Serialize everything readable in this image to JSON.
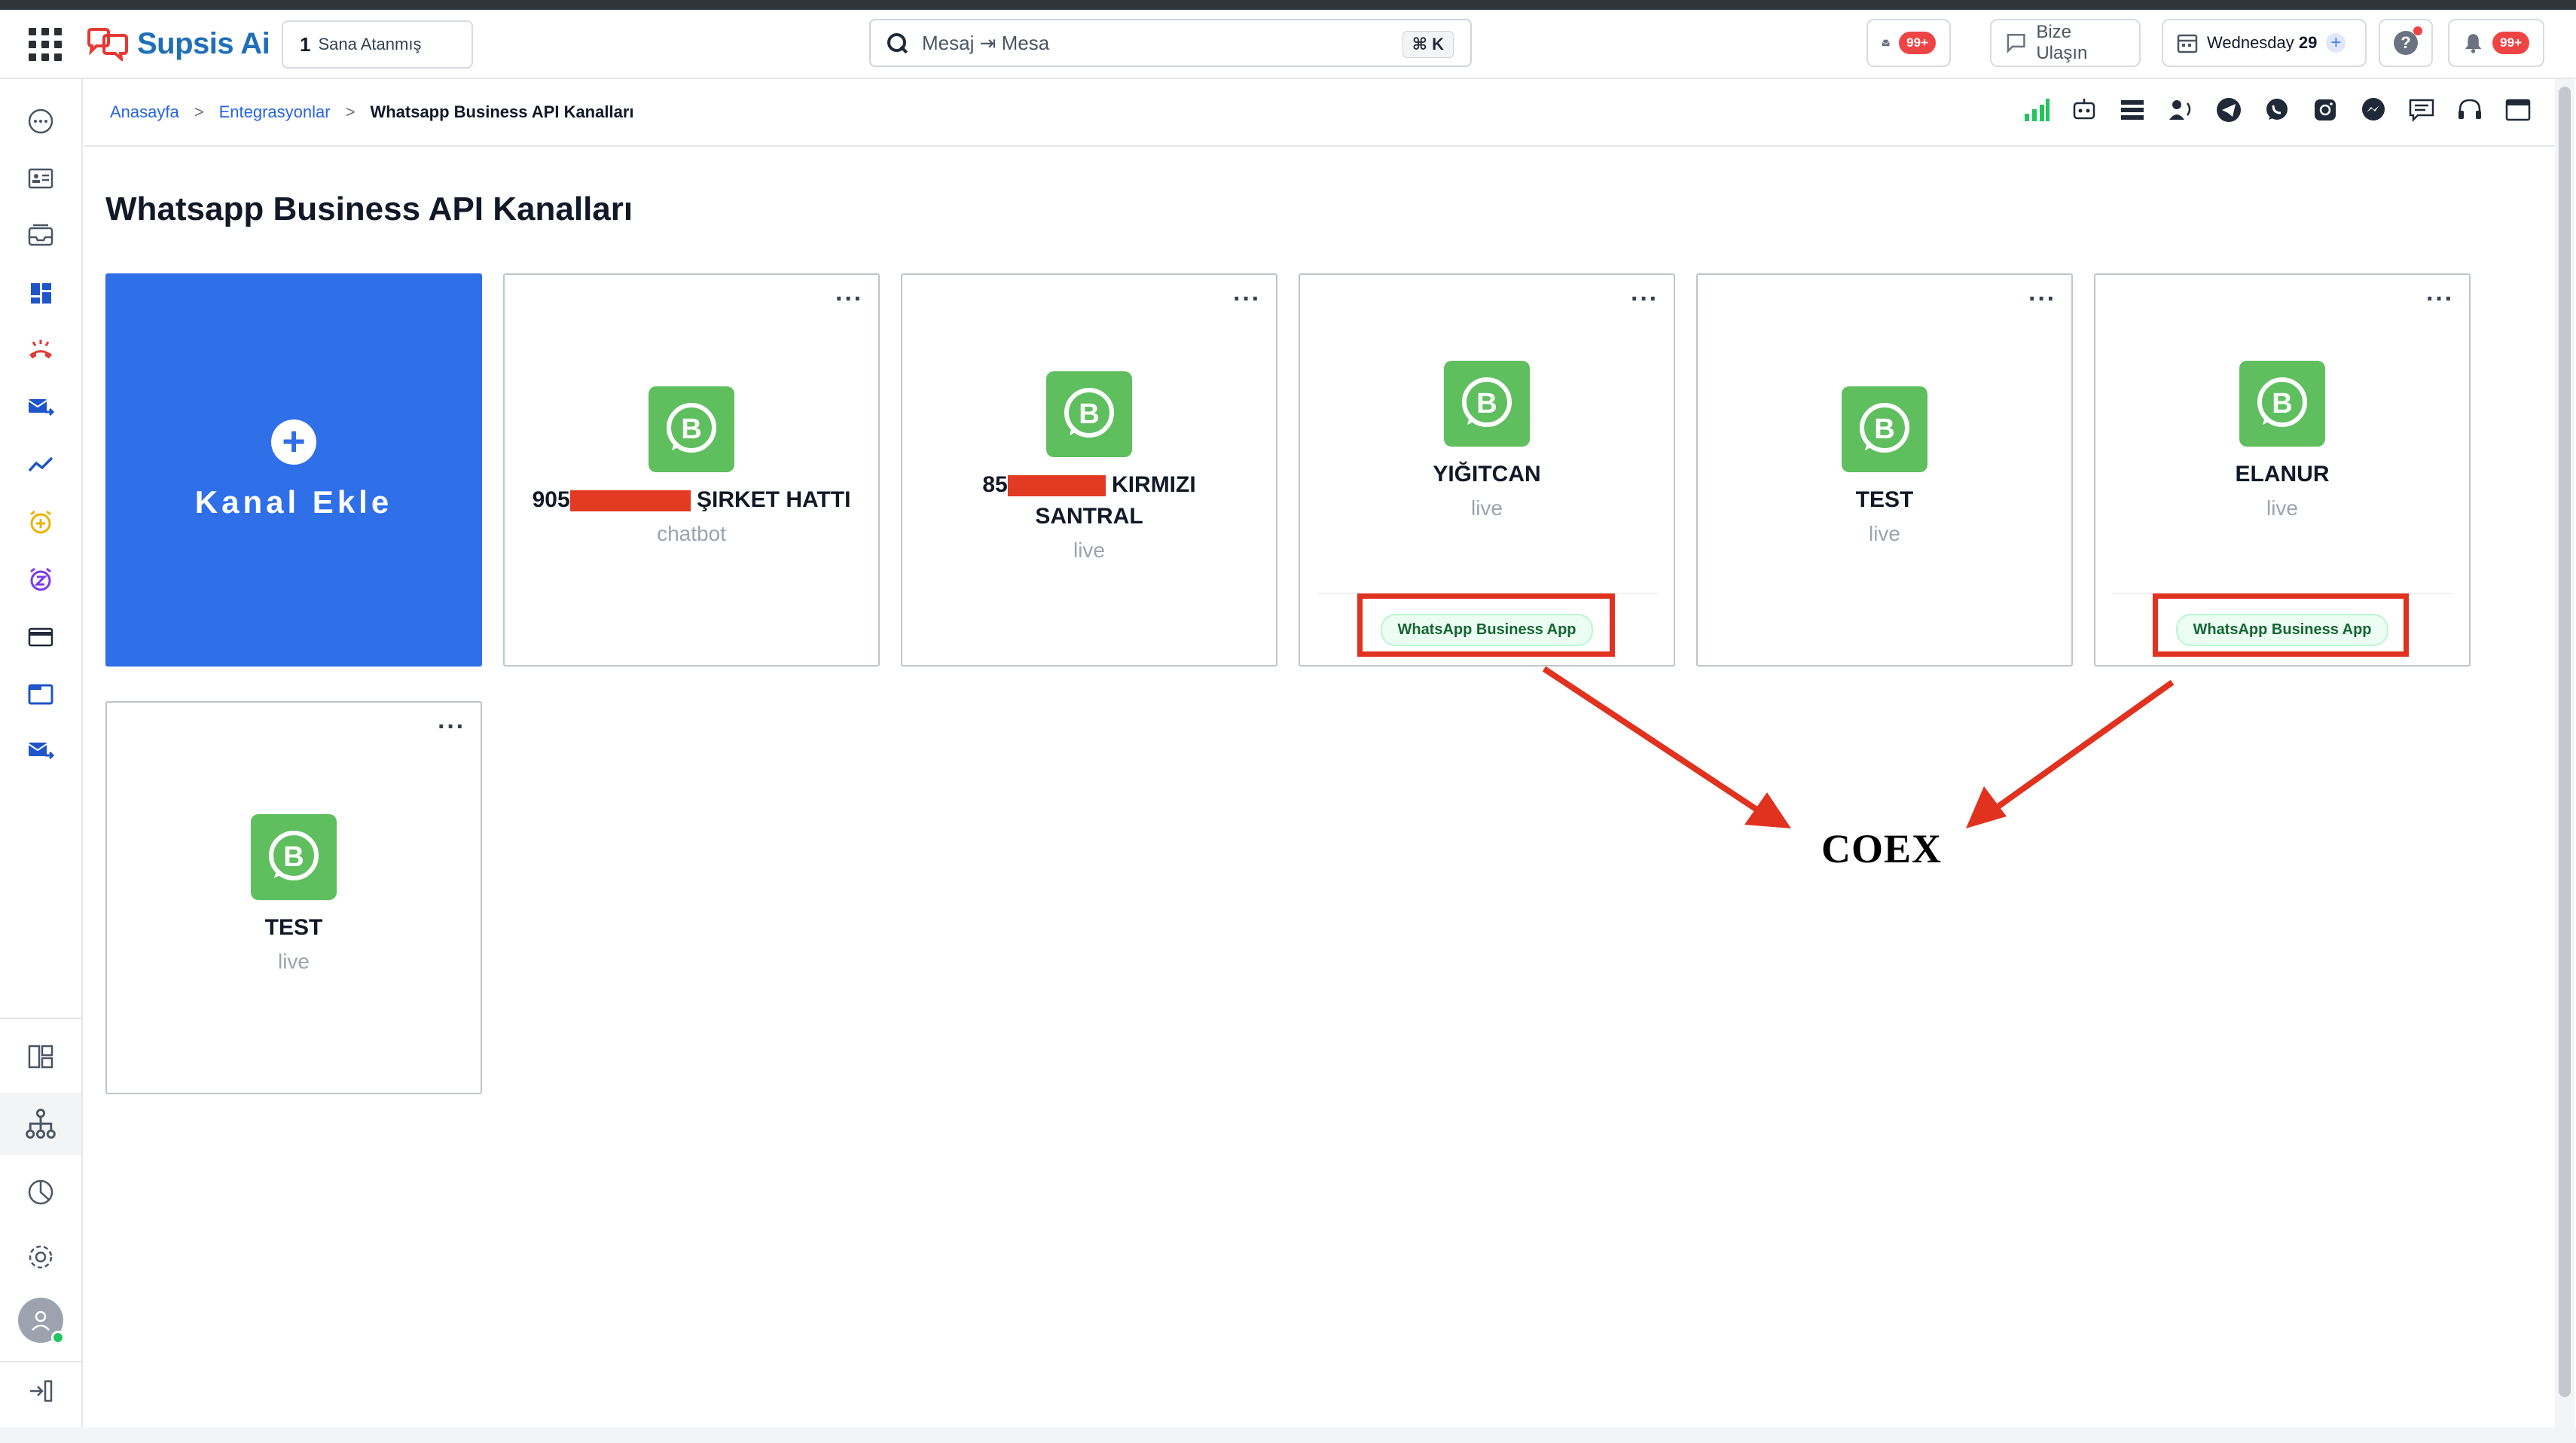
{
  "app": {
    "name": "Supsis Ai",
    "assigned_count": "1",
    "assigned_label": "Sana Atanmış"
  },
  "search": {
    "value": "Mesaj ⇥ Mesa",
    "shortcut": "⌘ K"
  },
  "topbar": {
    "mail_badge": "99+",
    "contact_label": "Bize Ulaşın",
    "date_day": "Wednesday",
    "date_num": "29",
    "notif_badge": "99+"
  },
  "breadcrumb": {
    "items": [
      "Anasayfa",
      "Entegrasyonlar"
    ],
    "current": "Whatsapp Business API Kanalları"
  },
  "page": {
    "title": "Whatsapp Business API Kanalları"
  },
  "add_card": {
    "label": "Kanal Ekle"
  },
  "channels": [
    {
      "name_prefix": "905",
      "name_suffix": "ŞIRKET HATTI",
      "status": "chatbot",
      "badge": ""
    },
    {
      "name_prefix": "85",
      "name_suffix": "KIRMIZI",
      "name_line2": "SANTRAL",
      "status": "live",
      "badge": ""
    },
    {
      "name": "YIĞITCAN",
      "status": "live",
      "badge": "WhatsApp Business App"
    },
    {
      "name": "TEST",
      "status": "live",
      "badge": ""
    },
    {
      "name": "ELANUR",
      "status": "live",
      "badge": "WhatsApp Business App"
    },
    {
      "name": "TEST",
      "status": "live",
      "badge": ""
    }
  ],
  "annotation": {
    "label": "COEX",
    "color": "#e0321f"
  },
  "colors": {
    "primary": "#2f6fe8",
    "whatsapp": "#5fbf5f",
    "link": "#2563eb"
  },
  "icons": {
    "sidebar": [
      "chat-icon",
      "contacts-icon",
      "inbox-icon",
      "dashboard-icon",
      "phone-icon",
      "mail-forward-icon",
      "analytics-icon",
      "alarm-add-icon",
      "snooze-icon",
      "card-icon",
      "window-icon",
      "mail-send-icon",
      "layout-icon",
      "hierarchy-icon",
      "pie-chart-icon",
      "settings-icon",
      "user-avatar",
      "collapse-icon"
    ],
    "channels": [
      "signal-bars-icon",
      "bot-icon",
      "list-icon",
      "announce-icon",
      "telegram-icon",
      "whatsapp-icon",
      "instagram-icon",
      "messenger-icon",
      "sms-icon",
      "headset-icon",
      "browser-icon"
    ]
  }
}
